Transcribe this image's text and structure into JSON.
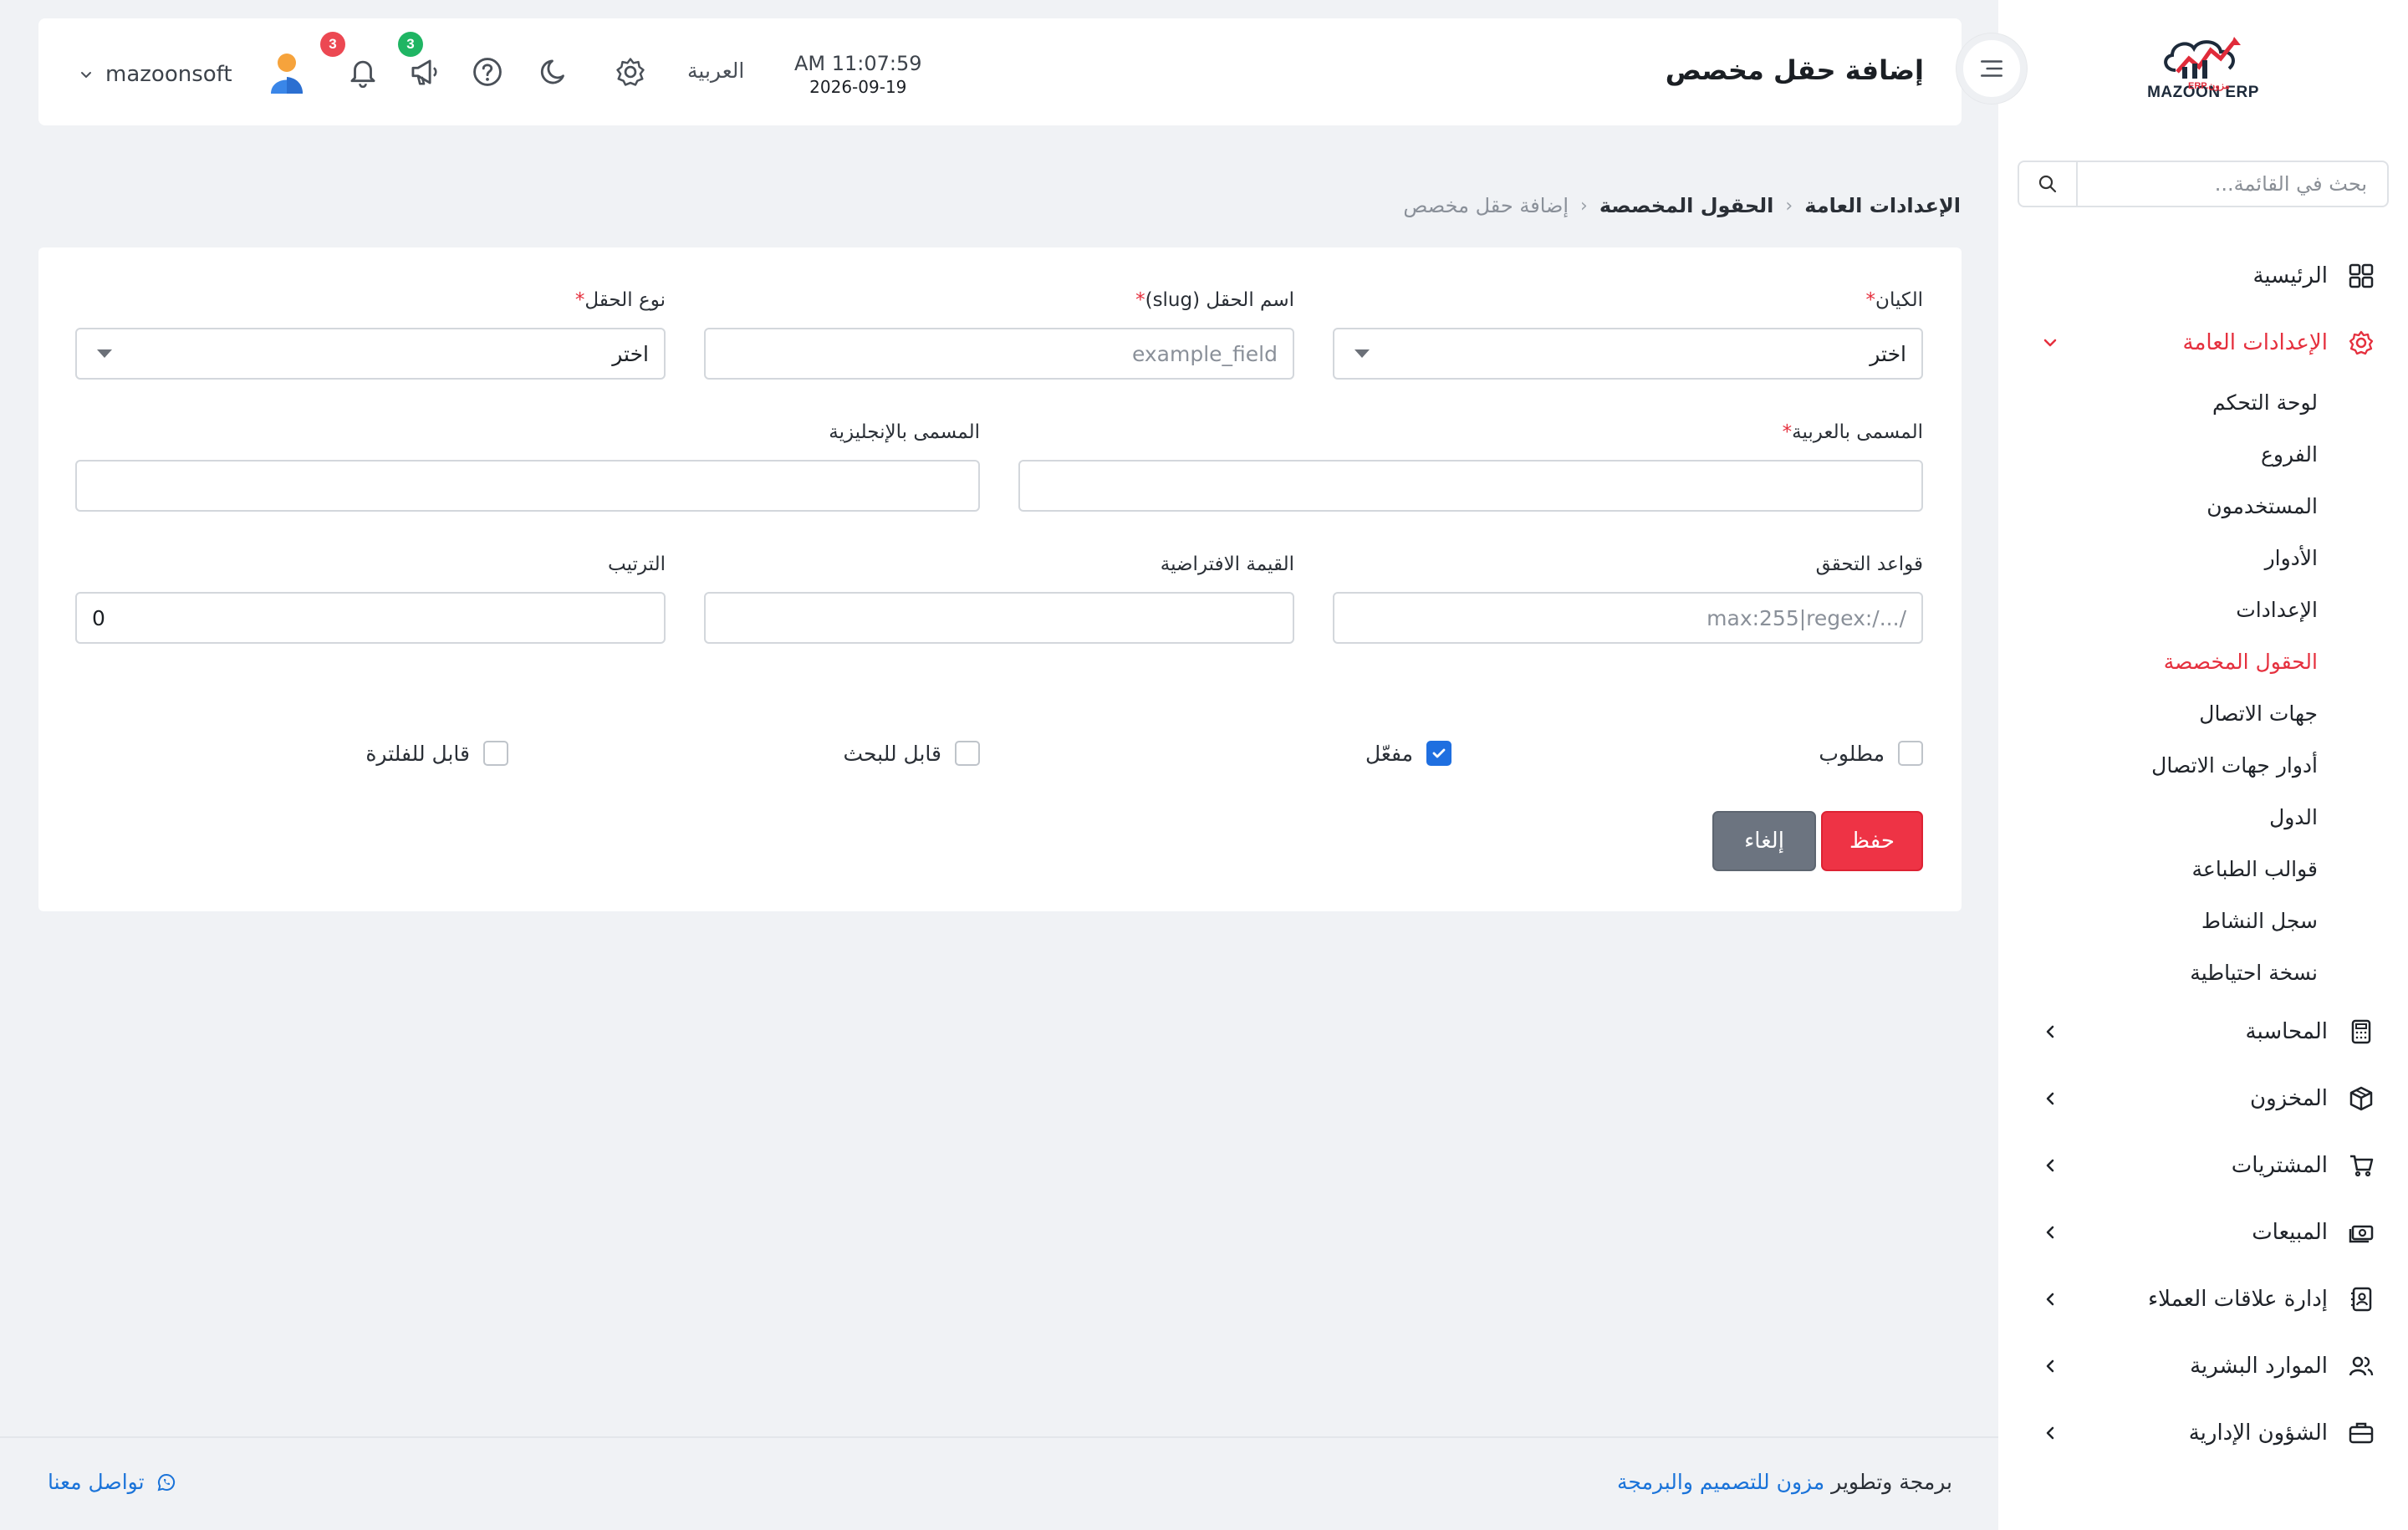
{
  "app": {
    "logo_text": "MAZOON ERP",
    "logo_sub": "ERP.مزون"
  },
  "sidebar": {
    "search_placeholder": "بحث في القائمة...",
    "items": [
      {
        "label": "الرئيسية",
        "icon": "grid-icon"
      },
      {
        "label": "الإعدادات العامة",
        "icon": "gear-icon",
        "expanded": true
      },
      {
        "label": "المحاسبة",
        "icon": "calculator-icon"
      },
      {
        "label": "المخزون",
        "icon": "box-icon"
      },
      {
        "label": "المشتريات",
        "icon": "cart-icon"
      },
      {
        "label": "المبيعات",
        "icon": "cash-icon"
      },
      {
        "label": "إدارة علاقات العملاء",
        "icon": "contacts-icon"
      },
      {
        "label": "الموارد البشرية",
        "icon": "users-icon"
      },
      {
        "label": "الشؤون الإدارية",
        "icon": "briefcase-icon"
      }
    ],
    "submenu": [
      {
        "label": "لوحة التحكم"
      },
      {
        "label": "الفروع"
      },
      {
        "label": "المستخدمون"
      },
      {
        "label": "الأدوار"
      },
      {
        "label": "الإعدادات"
      },
      {
        "label": "الحقول المخصصة",
        "active": true
      },
      {
        "label": "جهات الاتصال"
      },
      {
        "label": "أدوار جهات الاتصال"
      },
      {
        "label": "الدول"
      },
      {
        "label": "قوالب الطباعة"
      },
      {
        "label": "سجل النشاط"
      },
      {
        "label": "نسخة احتياطية"
      }
    ]
  },
  "header": {
    "title": "إضافة حقل مخصص",
    "time": "AM 11:07:59",
    "date": "2026-09-19",
    "language": "العربية",
    "announcements_count": "3",
    "notifications_count": "3",
    "username": "mazoonsoft"
  },
  "breadcrumb": {
    "items": [
      "الإعدادات العامة",
      "الحقول المخصصة",
      "إضافة حقل مخصص"
    ]
  },
  "form": {
    "entity": {
      "label": "الكيان",
      "value": "اختر"
    },
    "slug": {
      "label": "اسم الحقل (slug)",
      "placeholder": "example_field"
    },
    "field_type": {
      "label": "نوع الحقل",
      "value": "اختر"
    },
    "label_ar": {
      "label": "المسمى بالعربية"
    },
    "label_en": {
      "label": "المسمى بالإنجليزية"
    },
    "validation": {
      "label": "قواعد التحقق",
      "placeholder": "max:255|regex:/.../"
    },
    "default_value": {
      "label": "القيمة الافتراضية"
    },
    "order": {
      "label": "الترتيب",
      "value": "0"
    },
    "checkboxes": {
      "required": {
        "label": "مطلوب",
        "checked": false
      },
      "enabled": {
        "label": "مفعّل",
        "checked": true
      },
      "searchable": {
        "label": "قابل للبحث",
        "checked": false
      },
      "filterable": {
        "label": "قابل للفلترة",
        "checked": false
      }
    },
    "save_label": "حفظ",
    "cancel_label": "إلغاء"
  },
  "footer": {
    "credit_prefix": "برمجة وتطوير",
    "credit_brand": "مزون للتصميم والبرمجة",
    "contact_label": "تواصل معنا"
  },
  "colors": {
    "accent": "#e5303e",
    "link": "#1a73d9",
    "checkbox_on": "#1f6fe0",
    "cancel": "#6c7480"
  }
}
